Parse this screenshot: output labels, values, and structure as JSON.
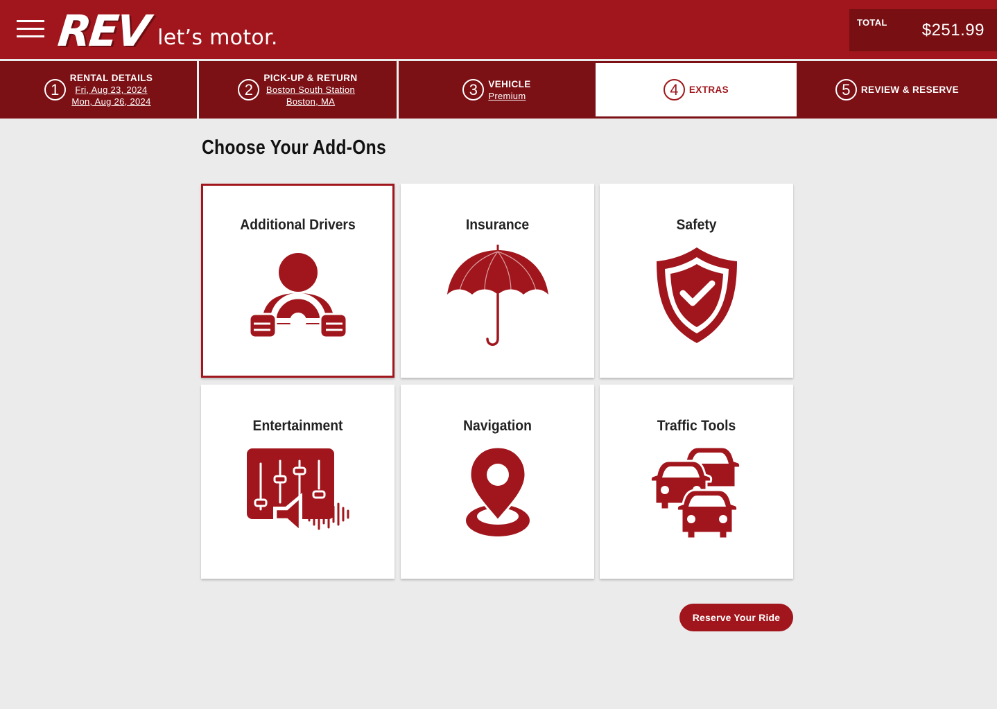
{
  "header": {
    "logo_rev": "REV",
    "logo_tagline": "let’s motor.",
    "total_label": "TOTAL",
    "total_amount": "$251.99"
  },
  "steps": [
    {
      "number": "1",
      "title": "RENTAL DETAILS",
      "lines": [
        "Fri, Aug 23, 2024",
        "Mon, Aug 26, 2024"
      ]
    },
    {
      "number": "2",
      "title": "PICK-UP & RETURN",
      "lines": [
        "Boston South Station",
        "Boston, MA"
      ]
    },
    {
      "number": "3",
      "title": "VEHICLE",
      "lines": [
        "Premium"
      ]
    },
    {
      "number": "4",
      "title": "EXTRAS",
      "lines": [],
      "active": true
    },
    {
      "number": "5",
      "title": "REVIEW & RESERVE",
      "lines": []
    }
  ],
  "main": {
    "title": "Choose Your Add-Ons",
    "addons": [
      {
        "label": "Additional Drivers",
        "icon": "driver-steering-wheel-icon",
        "selected": true
      },
      {
        "label": "Insurance",
        "icon": "umbrella-icon",
        "selected": false
      },
      {
        "label": "Safety",
        "icon": "shield-check-icon",
        "selected": false
      },
      {
        "label": "Entertainment",
        "icon": "audio-mixer-speaker-icon",
        "selected": false
      },
      {
        "label": "Navigation",
        "icon": "map-pin-icon",
        "selected": false
      },
      {
        "label": "Traffic Tools",
        "icon": "traffic-cars-icon",
        "selected": false
      }
    ],
    "reserve_label": "Reserve Your Ride"
  },
  "colors": {
    "brand_red": "#a0161c",
    "dark_red": "#7b1015",
    "background": "#ebebeb"
  }
}
